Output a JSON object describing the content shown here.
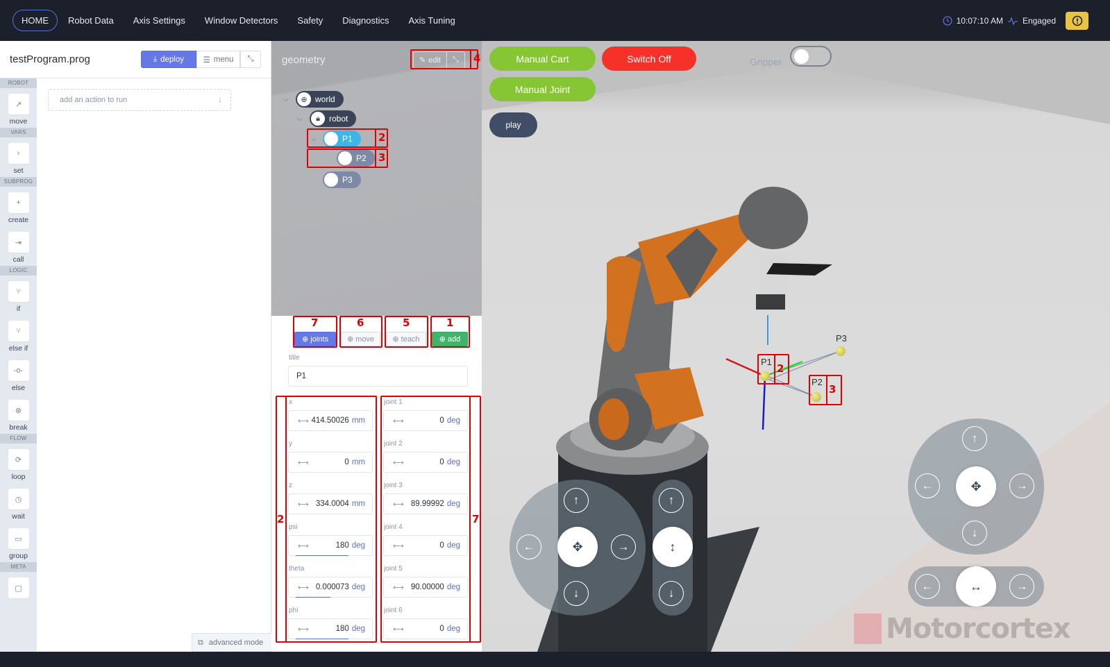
{
  "topbar": {
    "nav": [
      {
        "label": "HOME",
        "active": true
      },
      {
        "label": "Robot Data"
      },
      {
        "label": "Axis Settings"
      },
      {
        "label": "Window Detectors"
      },
      {
        "label": "Safety"
      },
      {
        "label": "Diagnostics"
      },
      {
        "label": "Axis Tuning"
      }
    ],
    "time": "10:07:10 AM",
    "status": "Engaged",
    "alert_icon": "exclamation-circle-icon"
  },
  "program": {
    "title": "testProgram.prog",
    "deploy_label": "deploy",
    "menu_label": "menu",
    "action_placeholder": "add an action to run",
    "advanced_mode_label": "advanced mode"
  },
  "palette": {
    "sections": [
      {
        "name": "ROBOT",
        "items": [
          {
            "label": "move",
            "icon": "↗"
          }
        ]
      },
      {
        "name": "VARS",
        "items": [
          {
            "label": "set",
            "icon": "›"
          }
        ]
      },
      {
        "name": "SUBPROG",
        "items": [
          {
            "label": "create",
            "icon": "+"
          },
          {
            "label": "call",
            "icon": "⇥"
          }
        ]
      },
      {
        "name": "LOGIC",
        "items": [
          {
            "label": "if",
            "icon": "⑂"
          },
          {
            "label": "else if",
            "icon": "⑂"
          },
          {
            "label": "else",
            "icon": "-o-"
          },
          {
            "label": "break",
            "icon": "⊗"
          }
        ]
      },
      {
        "name": "FLOW",
        "items": [
          {
            "label": "loop",
            "icon": "⟳"
          },
          {
            "label": "wait",
            "icon": "◷"
          },
          {
            "label": "group",
            "icon": "▭"
          }
        ]
      },
      {
        "name": "META",
        "items": [
          {
            "label": "",
            "icon": "▢"
          }
        ]
      }
    ]
  },
  "geometry": {
    "title": "geometry",
    "edit_label": "edit",
    "tree": {
      "world": "world",
      "robot": "robot",
      "points": [
        "P1",
        "P2",
        "P3"
      ]
    }
  },
  "props": {
    "buttons": {
      "joints": "joints",
      "move": "move",
      "teach": "teach",
      "add": "add"
    },
    "title_label": "title",
    "title_value": "P1",
    "cartesian": [
      {
        "label": "x",
        "value": "414.50026",
        "unit": "mm"
      },
      {
        "label": "y",
        "value": "0",
        "unit": "mm"
      },
      {
        "label": "z",
        "value": "334.0004",
        "unit": "mm"
      },
      {
        "label": "psi",
        "value": "180",
        "unit": "deg"
      },
      {
        "label": "theta",
        "value": "0.000073",
        "unit": "deg"
      },
      {
        "label": "phi",
        "value": "180",
        "unit": "deg"
      }
    ],
    "joints": [
      {
        "label": "joint 1",
        "value": "0",
        "unit": "deg"
      },
      {
        "label": "joint 2",
        "value": "0",
        "unit": "deg"
      },
      {
        "label": "joint 3",
        "value": "89.99992",
        "unit": "deg"
      },
      {
        "label": "joint 4",
        "value": "0",
        "unit": "deg"
      },
      {
        "label": "joint 5",
        "value": "90.00000",
        "unit": "deg"
      },
      {
        "label": "joint 6",
        "value": "0",
        "unit": "deg"
      }
    ]
  },
  "scene": {
    "manual_cart": "Manual Cart",
    "switch_off": "Switch Off",
    "manual_joint": "Manual Joint",
    "play": "play",
    "gripper_label": "Gripper",
    "gripper_on": false,
    "point_labels": [
      "P1",
      "P2",
      "P3"
    ],
    "logo": "Motorcortex",
    "colors": {
      "green": "#86c634",
      "red": "#f5312a",
      "navy": "#414d66"
    }
  },
  "annotations": [
    "1",
    "2",
    "3",
    "4",
    "5",
    "6",
    "7"
  ]
}
